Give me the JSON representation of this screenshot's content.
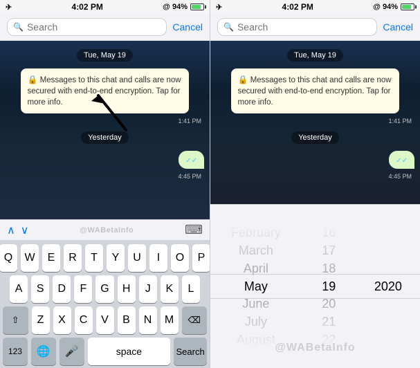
{
  "left_panel": {
    "status_bar": {
      "airplane": "✈",
      "time": "4:02 PM",
      "signal": "@ 94%"
    },
    "search": {
      "placeholder": "Search",
      "cancel_label": "Cancel"
    },
    "chat": {
      "date_badge": "Tue, May 19",
      "system_msg": "Messages to this chat and calls are now secured with end-to-end encryption. Tap for more info.",
      "msg_time": "1:41 PM",
      "yesterday_badge": "Yesterday",
      "bubble_time": "4:45 PM"
    },
    "nav": {
      "up": "∧",
      "down": "∨",
      "watermark": "@WABetaInfo"
    },
    "keyboard": {
      "rows": [
        [
          "Q",
          "W",
          "E",
          "R",
          "T",
          "Y",
          "U",
          "I",
          "O",
          "P"
        ],
        [
          "A",
          "S",
          "D",
          "F",
          "G",
          "H",
          "J",
          "K",
          "L"
        ],
        [
          "⇧",
          "Z",
          "X",
          "C",
          "V",
          "B",
          "N",
          "M",
          "⌫"
        ],
        [
          "123",
          "🌐",
          "🎤",
          "space",
          "Search"
        ]
      ]
    }
  },
  "right_panel": {
    "status_bar": {
      "airplane": "✈",
      "time": "4:02 PM",
      "signal": "@ 94%"
    },
    "search": {
      "placeholder": "Search",
      "cancel_label": "Cancel"
    },
    "chat": {
      "date_badge": "Tue, May 19",
      "system_msg": "Messages to this chat and calls are now secured with end-to-end encryption. Tap for more info.",
      "msg_time": "1:41 PM",
      "yesterday_badge": "Yesterday",
      "bubble_time": "4:45 PM"
    },
    "watermark": "@WABetaInfo",
    "date_picker": {
      "months": [
        "February",
        "March",
        "April",
        "May",
        "June",
        "July",
        "August"
      ],
      "days": [
        "16",
        "17",
        "18",
        "19",
        "20",
        "21",
        "22"
      ],
      "years": [
        "2020"
      ],
      "selected_month": "May",
      "selected_day": "19",
      "selected_year": "2020"
    }
  }
}
